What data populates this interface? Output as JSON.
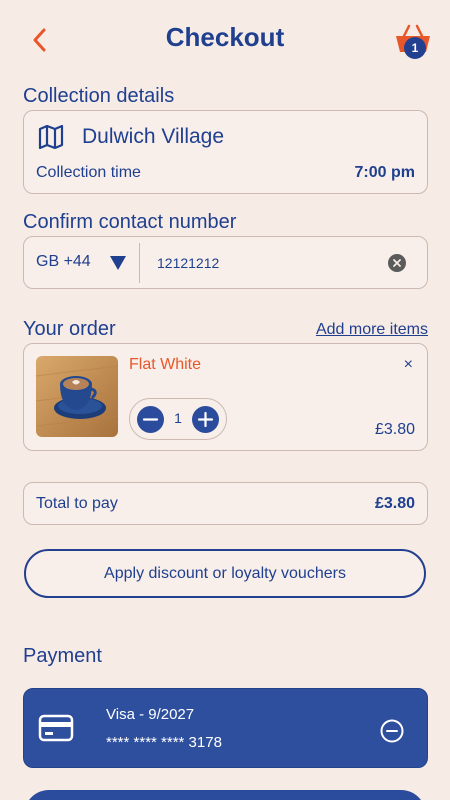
{
  "header": {
    "title": "Checkout",
    "basket_count": "1",
    "back_icon": "chevron-left-icon",
    "basket_icon": "basket-icon"
  },
  "collection": {
    "section_title": "Collection details",
    "location": "Dulwich Village",
    "time_label": "Collection time",
    "time_value": "7:00 pm"
  },
  "contact": {
    "section_title": "Confirm contact number",
    "country_code": "GB +44",
    "phone": "12121212"
  },
  "order": {
    "section_title": "Your order",
    "add_more": "Add more items",
    "items": [
      {
        "name": "Flat White",
        "quantity": "1",
        "price": "£3.80",
        "remove": "×"
      }
    ]
  },
  "total": {
    "label": "Total to pay",
    "value": "£3.80"
  },
  "discount": {
    "label": "Apply discount or loyalty vouchers"
  },
  "payment": {
    "section_title": "Payment",
    "card_name": "Visa - 9/2027",
    "card_number": "**** **** **** 3178"
  },
  "colors": {
    "primary": "#1f3f8f",
    "accent": "#e8572a",
    "background": "#f7ebe6",
    "card_blue": "#2e4f9e"
  }
}
